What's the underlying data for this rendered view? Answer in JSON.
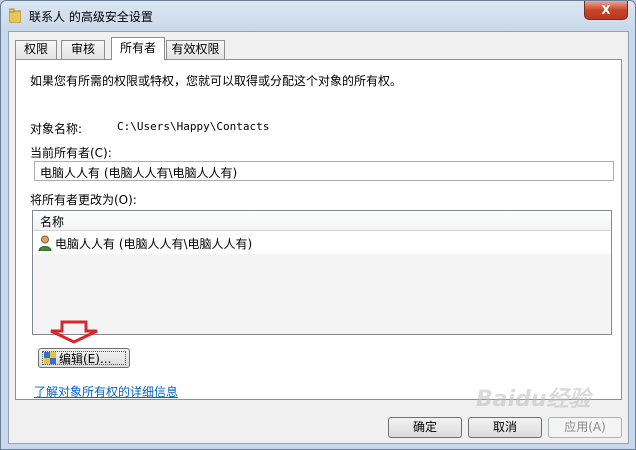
{
  "window": {
    "title": "联系人 的高级安全设置",
    "close_glyph": "X"
  },
  "tabs": [
    {
      "label": "权限",
      "active": false
    },
    {
      "label": "审核",
      "active": false
    },
    {
      "label": "所有者",
      "active": true
    },
    {
      "label": "有效权限",
      "active": false
    }
  ],
  "owner_page": {
    "intro": "如果您有所需的权限或特权，您就可以取得或分配这个对象的所有权。",
    "object_name_label": "对象名称:",
    "object_name_value": "C:\\Users\\Happy\\Contacts",
    "current_owner_label": "当前所有者(C):",
    "current_owner_value": "电脑人人有 (电脑人人有\\电脑人人有)",
    "change_owner_label": "将所有者更改为(O):",
    "list_header": "名称",
    "list_rows": [
      "电脑人人有 (电脑人人有\\电脑人人有)"
    ],
    "edit_button": "编辑(E)...",
    "learn_more_link": "了解对象所有权的详细信息"
  },
  "buttons": {
    "ok": "确定",
    "cancel": "取消",
    "apply": "应用(A)"
  },
  "watermark": "Baidu经验",
  "colors": {
    "annotation_arrow": "#d9262b",
    "link": "#0066cc",
    "close_button": "#c7452b"
  },
  "icons": [
    "folder-icon",
    "close-icon",
    "user-icon",
    "edit-shield-icon",
    "red-down-arrow-icon"
  ]
}
